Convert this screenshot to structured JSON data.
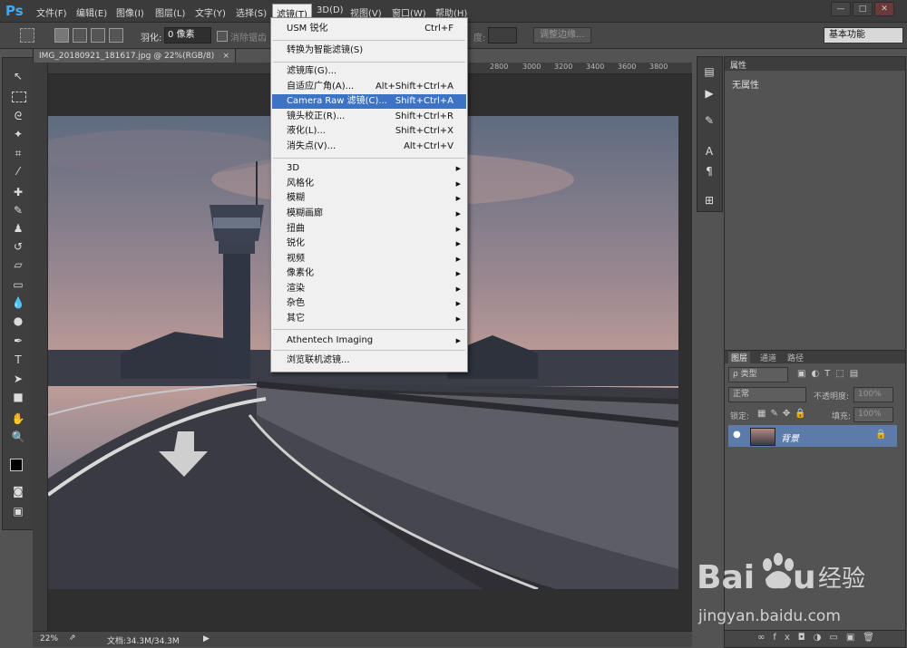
{
  "app": {
    "logo": "Ps"
  },
  "menubar": {
    "items": [
      "文件(F)",
      "编辑(E)",
      "图像(I)",
      "图层(L)",
      "文字(Y)",
      "选择(S)",
      "滤镜(T)",
      "3D(D)",
      "视图(V)",
      "窗口(W)",
      "帮助(H)"
    ],
    "window_buttons": [
      "—",
      "□",
      "✕"
    ]
  },
  "options": {
    "feather_label": "羽化:",
    "feather_value": "0 像素",
    "antialias_label": "消除锯齿",
    "width_label": "度:",
    "refine_edge_btn": "调整边缘...",
    "workspace_select": "基本功能"
  },
  "document": {
    "tab_title": "IMG_20180921_181617.jpg @ 22%(RGB/8)",
    "close": "×",
    "ruler_ticks": [
      "2800",
      "3000",
      "3200",
      "3400",
      "3600",
      "3800"
    ],
    "zoom": "22%",
    "doc_info": "文档:34.3M/34.3M"
  },
  "filter_menu": {
    "items": [
      {
        "label": "USM 锐化",
        "shortcut": "Ctrl+F"
      },
      {
        "label": "转换为智能滤镜(S)",
        "shortcut": ""
      },
      {
        "label": "滤镜库(G)...",
        "shortcut": ""
      },
      {
        "label": "自适应广角(A)...",
        "shortcut": "Alt+Shift+Ctrl+A"
      },
      {
        "label": "Camera Raw 滤镜(C)...",
        "shortcut": "Shift+Ctrl+A"
      },
      {
        "label": "镜头校正(R)...",
        "shortcut": "Shift+Ctrl+R"
      },
      {
        "label": "液化(L)...",
        "shortcut": "Shift+Ctrl+X"
      },
      {
        "label": "消失点(V)...",
        "shortcut": "Alt+Ctrl+V"
      },
      {
        "label": "3D",
        "shortcut": ""
      },
      {
        "label": "风格化",
        "shortcut": ""
      },
      {
        "label": "模糊",
        "shortcut": ""
      },
      {
        "label": "模糊画廊",
        "shortcut": ""
      },
      {
        "label": "扭曲",
        "shortcut": ""
      },
      {
        "label": "锐化",
        "shortcut": ""
      },
      {
        "label": "视频",
        "shortcut": ""
      },
      {
        "label": "像素化",
        "shortcut": ""
      },
      {
        "label": "渲染",
        "shortcut": ""
      },
      {
        "label": "杂色",
        "shortcut": ""
      },
      {
        "label": "其它",
        "shortcut": ""
      },
      {
        "label": "Athentech Imaging",
        "shortcut": ""
      },
      {
        "label": "浏览联机滤镜...",
        "shortcut": ""
      }
    ],
    "highlighted_index": 4
  },
  "properties": {
    "tab": "属性",
    "body": "无属性"
  },
  "layers": {
    "tabs": [
      "图层",
      "通道",
      "路径"
    ],
    "kind_filter": "ρ 类型",
    "blend_mode": "正常",
    "opacity_label": "不透明度:",
    "opacity_value": "100%",
    "lock_label": "锁定:",
    "fill_label": "填充:",
    "fill_value": "100%",
    "layer_name": "背景",
    "eye": "●",
    "lock": "🔒"
  },
  "colors": {
    "menu_highlight": "#3d73c4",
    "layer_selected": "#5c7ba8",
    "ps_blue": "#3fa9f5"
  }
}
